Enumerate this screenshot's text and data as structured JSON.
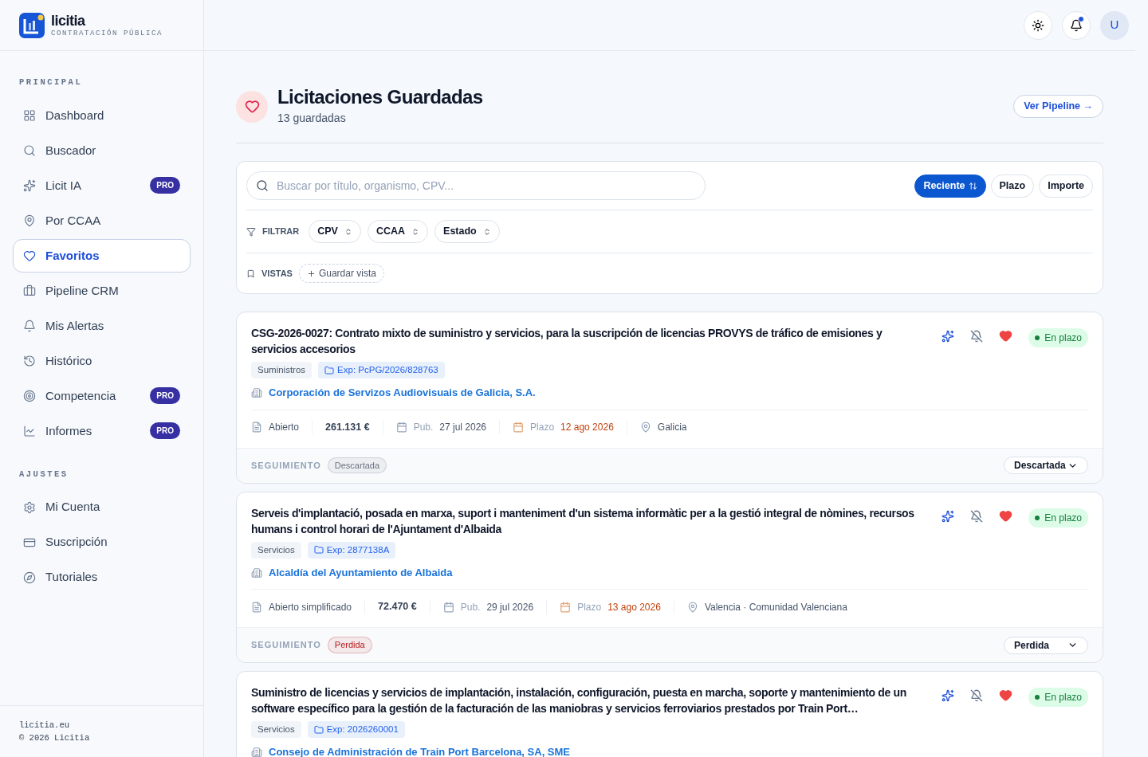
{
  "brand": {
    "name": "licitia",
    "tagline": "CONTRATACIÓN PÚBLICA"
  },
  "header": {
    "notifications_unread": true,
    "avatar": "U"
  },
  "sidebar": {
    "sections": [
      {
        "title": "PRINCIPAL",
        "items": [
          {
            "label": "Dashboard",
            "selected": false
          },
          {
            "label": "Buscador",
            "selected": false
          },
          {
            "label": "Licit IA",
            "selected": false,
            "badge": "PRO"
          },
          {
            "label": "Por CCAA",
            "selected": false
          },
          {
            "label": "Favoritos",
            "selected": true
          },
          {
            "label": "Pipeline CRM",
            "selected": false
          },
          {
            "label": "Mis Alertas",
            "selected": false
          },
          {
            "label": "Histórico",
            "selected": false
          },
          {
            "label": "Competencia",
            "selected": false,
            "badge": "PRO"
          },
          {
            "label": "Informes",
            "selected": false,
            "badge": "PRO"
          }
        ]
      },
      {
        "title": "AJUSTES",
        "items": [
          {
            "label": "Mi Cuenta",
            "selected": false
          },
          {
            "label": "Suscripción",
            "selected": false
          },
          {
            "label": "Tutoriales",
            "selected": false
          }
        ]
      }
    ],
    "footer": [
      "licitia.eu",
      "© 2026 Licitia"
    ]
  },
  "page": {
    "title": "Licitaciones Guardadas",
    "subtitle": "13 guardadas",
    "action": "Ver Pipeline →"
  },
  "filters": {
    "search_placeholder": "Buscar por título, organismo, CPV...",
    "sort": [
      {
        "label": "Reciente",
        "selected": true
      },
      {
        "label": "Plazo",
        "selected": false
      },
      {
        "label": "Importe",
        "selected": false
      }
    ],
    "filter_label": "FILTRAR",
    "filter_chips": [
      "CPV",
      "CCAA",
      "Estado"
    ],
    "views_label": "VISTAS",
    "save_view": "Guardar vista"
  },
  "tenders": [
    {
      "title": "CSG-2026-0027: Contrato mixto de suministro y servicios, para la suscripción de licencias PROVYS de tráfico de emisiones y servicios accesorios",
      "status": "En plazo",
      "favorite": true,
      "category": "Suministros",
      "expedient": "Exp: PcPG/2026/828763",
      "organization": "Corporación de Servizos Audiovisuais de Galicia, S.A.",
      "meta": {
        "procedure": "Abierto",
        "amount": "261.131 €",
        "pub_label": "Pub.",
        "pub_date": "27 jul 2026",
        "deadline_label": "Plazo",
        "deadline": "12 ago 2026",
        "location": "Galicia"
      },
      "tracking_label": "SEGUIMIENTO",
      "tracking": {
        "label": "Descartada",
        "color": "#6b7280"
      },
      "tracking_select": "Descartada"
    },
    {
      "title": "Serveis d'implantació, posada en marxa, suport i manteniment d'un sistema informàtic per a la gestió integral de nòmines, recursos humans i control horari de l'Ajuntament d'Albaida",
      "status": "En plazo",
      "favorite": true,
      "category": "Servicios",
      "expedient": "Exp: 2877138A",
      "organization": "Alcaldía del Ayuntamiento de Albaida",
      "meta": {
        "procedure": "Abierto simplificado",
        "amount": "72.470 €",
        "pub_label": "Pub.",
        "pub_date": "29 jul 2026",
        "deadline_label": "Plazo",
        "deadline": "13 ago 2026",
        "location": "Valencia · Comunidad Valenciana"
      },
      "tracking_label": "SEGUIMIENTO",
      "tracking": {
        "label": "Perdida",
        "color": "#b91c1c"
      },
      "tracking_select": "Perdida"
    },
    {
      "title": "Suministro de licencias y servicios de implantación, instalación, configuración, puesta en marcha, soporte y mantenimiento de un software específico para la gestión de la facturación de las maniobras y servicios ferroviarios prestados por Train Port…",
      "status": "En plazo",
      "favorite": true,
      "category": "Servicios",
      "expedient": "Exp: 2026260001",
      "organization": "Consejo de Administración de Train Port Barcelona, SA, SME"
    }
  ]
}
